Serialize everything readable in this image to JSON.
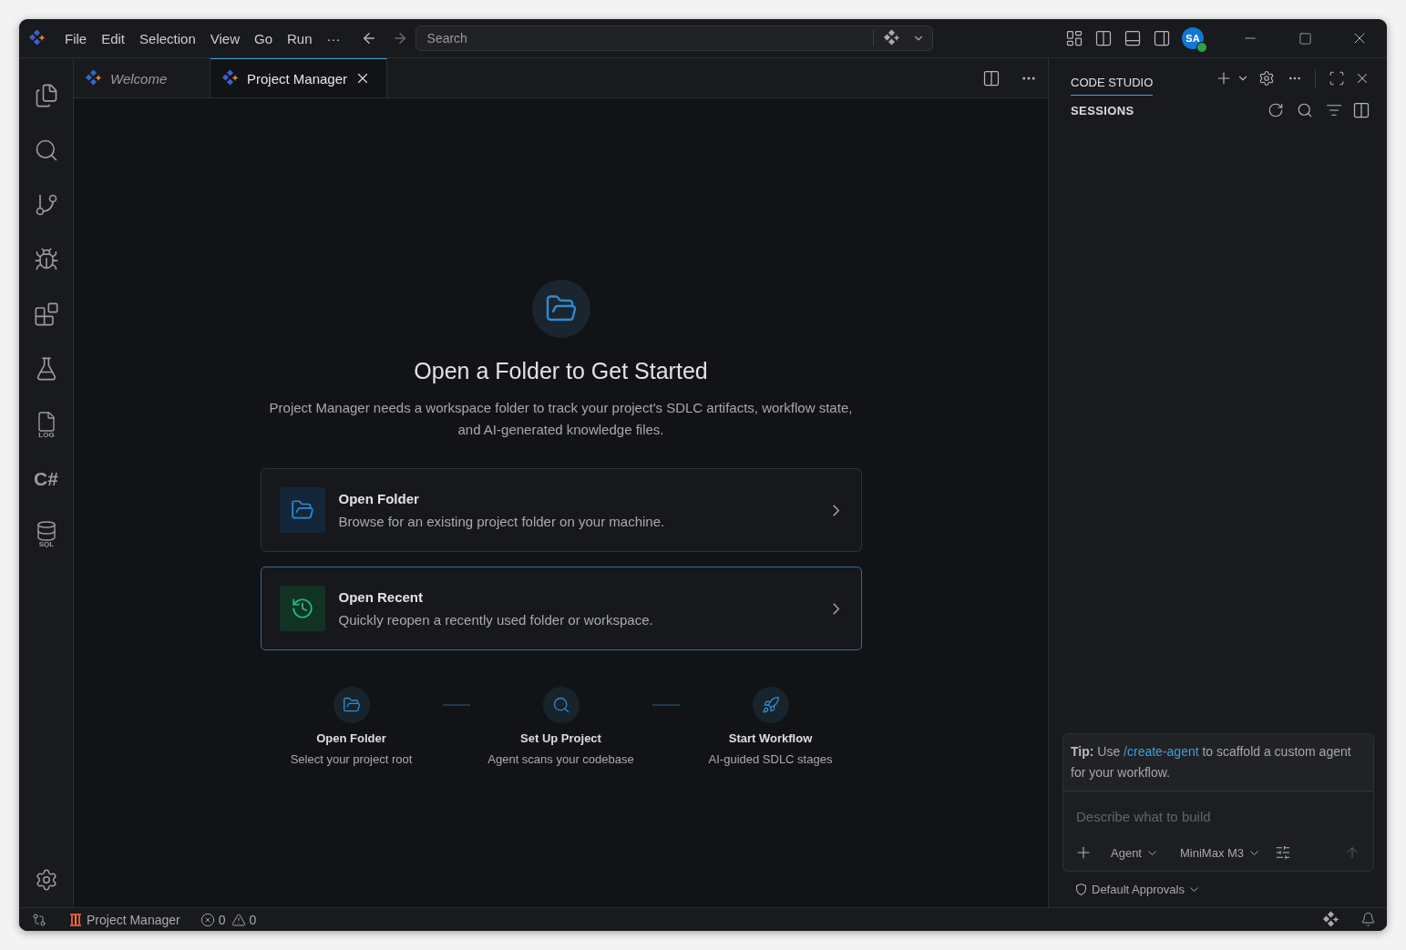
{
  "menu": [
    "File",
    "Edit",
    "Selection",
    "View",
    "Go",
    "Run",
    "···"
  ],
  "search": {
    "placeholder": "Search"
  },
  "account": {
    "initials": "SA",
    "online": true
  },
  "activity_bar": [
    {
      "kind": "files"
    },
    {
      "kind": "search"
    },
    {
      "kind": "branch"
    },
    {
      "kind": "debug"
    },
    {
      "kind": "blocks"
    },
    {
      "kind": "flask"
    },
    {
      "kind": "log",
      "label": "LOG"
    },
    {
      "kind": "text",
      "label": "C#"
    },
    {
      "kind": "sql",
      "label": "SQL"
    }
  ],
  "tabs": [
    {
      "label": "Welcome",
      "selected": false,
      "preview": true
    },
    {
      "label": "Project Manager",
      "selected": true,
      "preview": false
    }
  ],
  "main": {
    "title": "Open a Folder to Get Started",
    "description": "Project Manager needs a workspace folder to track your project's SDLC artifacts, workflow state, and AI-generated knowledge files.",
    "actions": [
      {
        "kind": "folder",
        "title": "Open Folder",
        "description": "Browse for an existing project folder on your machine.",
        "selected": false
      },
      {
        "kind": "recent",
        "title": "Open Recent",
        "description": "Quickly reopen a recently used folder or workspace.",
        "selected": true
      }
    ],
    "steps": [
      {
        "kind": "folder",
        "title": "Open Folder",
        "description": "Select your project root"
      },
      {
        "kind": "search",
        "title": "Set Up Project",
        "description": "Agent scans your codebase"
      },
      {
        "kind": "rocket",
        "title": "Start Workflow",
        "description": "AI-guided SDLC stages"
      }
    ]
  },
  "side_panel": {
    "title": "CODE STUDIO",
    "section": "SESSIONS",
    "tip": {
      "label": "Tip:",
      "before": "Use ",
      "link": "/create-agent",
      "after": " to scaffold a custom agent for your workflow."
    },
    "composer": {
      "placeholder": "Describe what to build",
      "mode": "Agent",
      "model": "MiniMax M3"
    },
    "approvals": "Default Approvals"
  },
  "status_bar": {
    "project": "Project Manager",
    "errors": "0",
    "warnings": "0"
  }
}
